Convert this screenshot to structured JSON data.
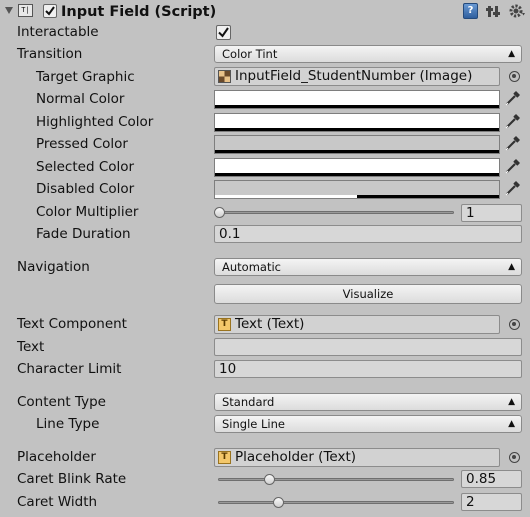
{
  "header": {
    "title": "Input Field (Script)",
    "enabled": true,
    "expanded": true
  },
  "interactable": {
    "label": "Interactable",
    "checked": true
  },
  "transition": {
    "label": "Transition",
    "value": "Color Tint"
  },
  "target_graphic": {
    "label": "Target Graphic",
    "value": "InputField_StudentNumber (Image)"
  },
  "colors": [
    {
      "label": "Normal Color",
      "hex": "#ffffff",
      "alpha": 1.0
    },
    {
      "label": "Highlighted Color",
      "hex": "#ffffff",
      "alpha": 1.0
    },
    {
      "label": "Pressed Color",
      "hex": "#c8c8c8",
      "alpha": 1.0
    },
    {
      "label": "Selected Color",
      "hex": "#ffffff",
      "alpha": 1.0
    },
    {
      "label": "Disabled Color",
      "hex": "#c8c8c8",
      "alpha": 0.5
    }
  ],
  "color_multiplier": {
    "label": "Color Multiplier",
    "value": "1",
    "fraction": 0.0
  },
  "fade_duration": {
    "label": "Fade Duration",
    "value": "0.1"
  },
  "navigation": {
    "label": "Navigation",
    "value": "Automatic",
    "visualize_label": "Visualize"
  },
  "text_component": {
    "label": "Text Component",
    "value": "Text (Text)"
  },
  "text": {
    "label": "Text",
    "value": ""
  },
  "character_limit": {
    "label": "Character Limit",
    "value": "10"
  },
  "content_type": {
    "label": "Content Type",
    "value": "Standard"
  },
  "line_type": {
    "label": "Line Type",
    "value": "Single Line"
  },
  "placeholder": {
    "label": "Placeholder",
    "value": "Placeholder (Text)"
  },
  "caret_blink_rate": {
    "label": "Caret Blink Rate",
    "value": "0.85",
    "fraction": 0.21
  },
  "caret_width": {
    "label": "Caret Width",
    "value": "2",
    "fraction": 0.25
  },
  "icons": [
    "foldout-arrow-icon",
    "script-component-icon",
    "checkbox-icon",
    "help-book-icon",
    "presets-icon",
    "gear-icon",
    "image-asset-icon",
    "text-component-icon",
    "eyedropper-icon",
    "object-picker-icon"
  ]
}
